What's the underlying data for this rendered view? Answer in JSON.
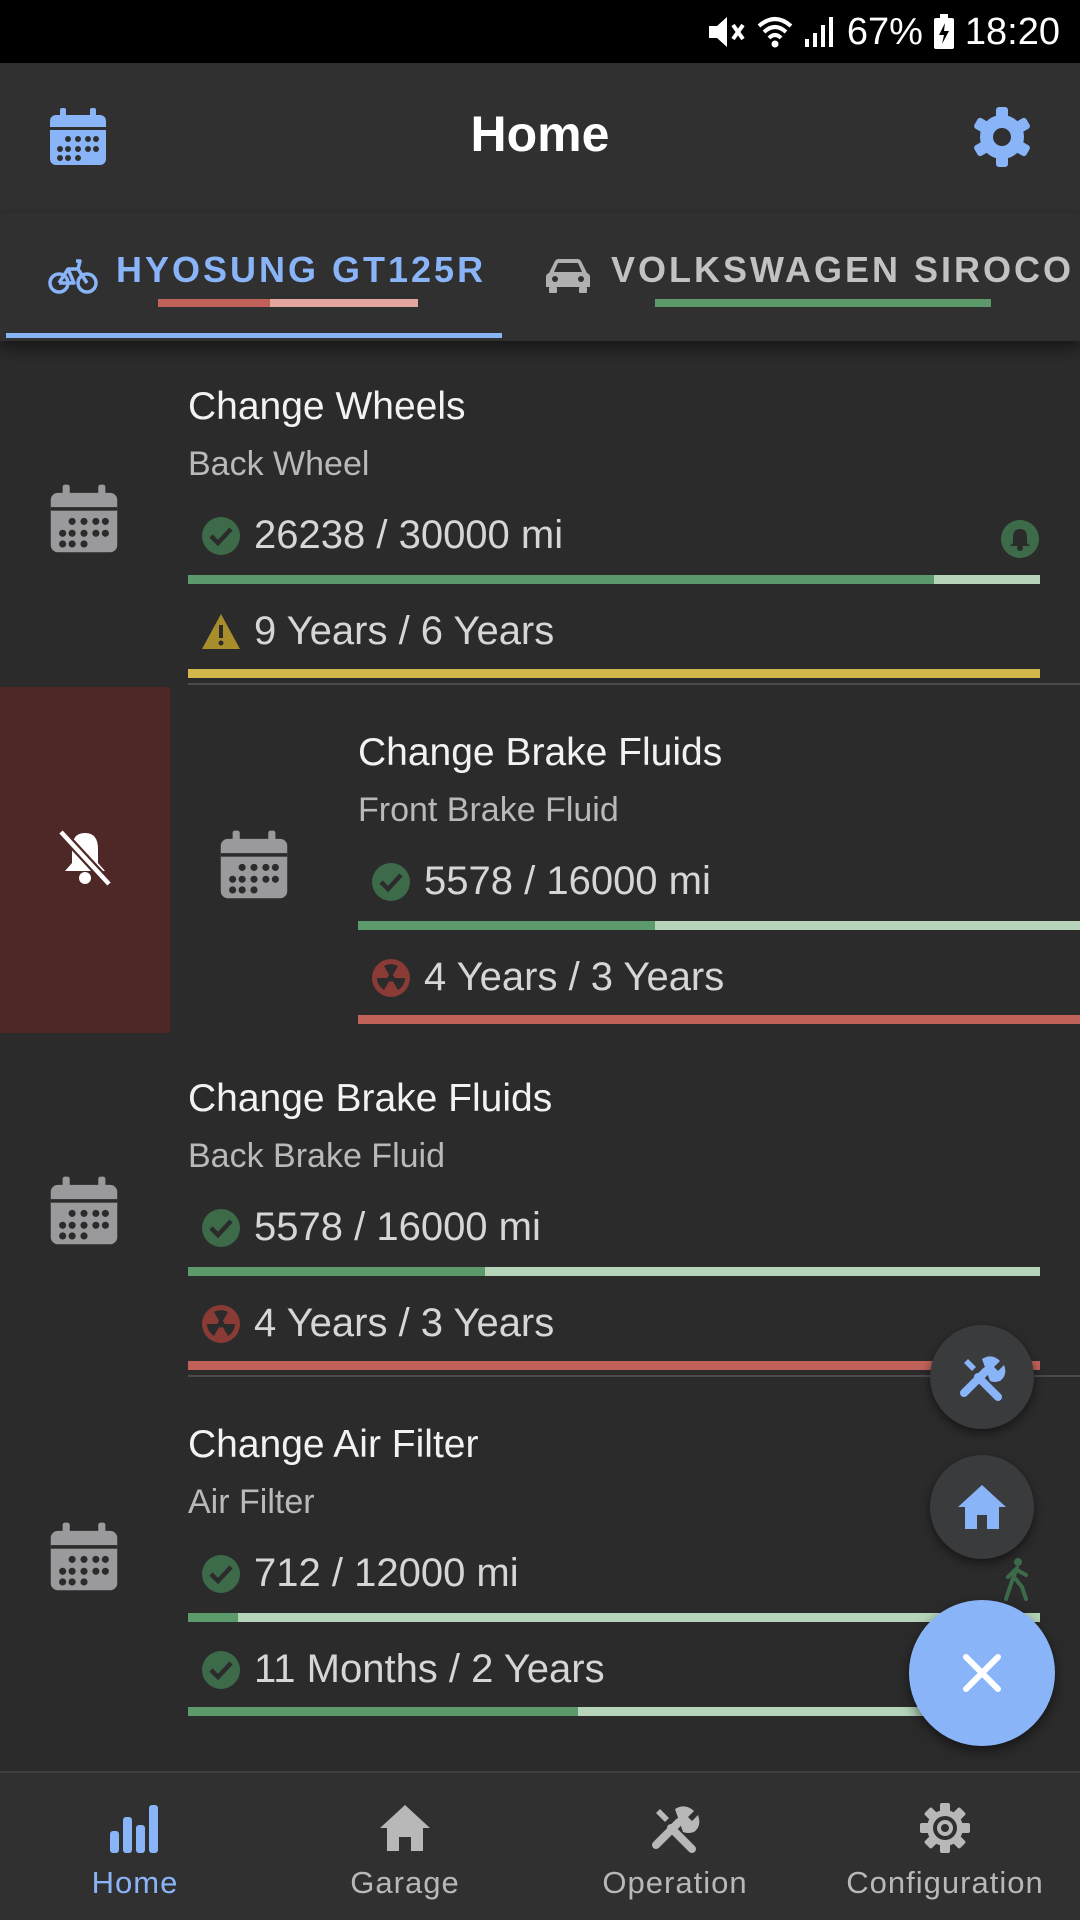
{
  "status_bar": {
    "battery": "67%",
    "time": "18:20"
  },
  "app_bar": {
    "title": "Home",
    "left_icon": "calendar-icon",
    "right_icon": "gear-icon"
  },
  "tabs": [
    {
      "label": "HYOSUNG GT125R",
      "icon": "bicycle-icon",
      "active": true
    },
    {
      "label": "VOLKSWAGEN SIROCO",
      "icon": "car-icon",
      "active": false
    }
  ],
  "items": [
    {
      "name": "Change Wheels",
      "sub": "Back Wheel",
      "distance": {
        "text": "26238 / 30000 mi",
        "status": "ok",
        "progress": 0.875
      },
      "time": {
        "text": "9 Years / 6 Years",
        "status": "warning",
        "progress": 1.0
      },
      "alert_icon": "bell-icon"
    },
    {
      "name": "Change Brake Fluids",
      "sub": "Front Brake Fluid",
      "distance": {
        "text": "5578 / 16000 mi",
        "status": "ok",
        "progress": 0.349
      },
      "time": {
        "text": "4 Years / 3 Years",
        "status": "overdue",
        "progress": 1.0
      },
      "swipe_action_icon": "bell-off-icon"
    },
    {
      "name": "Change Brake Fluids",
      "sub": "Back Brake Fluid",
      "distance": {
        "text": "5578 / 16000 mi",
        "status": "ok",
        "progress": 0.349
      },
      "time": {
        "text": "4 Years / 3 Years",
        "status": "overdue",
        "progress": 1.0
      }
    },
    {
      "name": "Change Air Filter",
      "sub": "Air Filter",
      "distance": {
        "text": "712 / 12000 mi",
        "status": "ok",
        "progress": 0.059
      },
      "time": {
        "text": "11 Months / 2 Years",
        "status": "ok",
        "progress": 0.458
      }
    }
  ],
  "fabs": {
    "operation_icon": "tools-icon",
    "garage_icon": "home-icon",
    "main_icon": "close-icon"
  },
  "bottom_nav": [
    {
      "label": "Home",
      "icon": "bar-chart-icon",
      "active": true
    },
    {
      "label": "Garage",
      "icon": "home-icon",
      "active": false
    },
    {
      "label": "Operation",
      "icon": "tools-icon",
      "active": false
    },
    {
      "label": "Configuration",
      "icon": "gear-icon",
      "active": false
    }
  ],
  "colors": {
    "accent": "#8ab4f8",
    "ok": "#5c9a6c",
    "ok_track": "#b5d4b9",
    "warning": "#d2b84a",
    "overdue": "#c0625a",
    "swipe_bg": "#4e2826"
  }
}
